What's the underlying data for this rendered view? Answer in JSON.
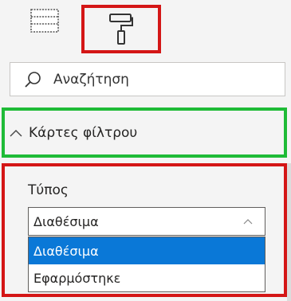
{
  "tabs": {
    "fields_icon": "table-icon",
    "format_icon": "paint-roller-icon"
  },
  "search": {
    "placeholder": "Αναζήτηση",
    "icon": "search-icon"
  },
  "section": {
    "title": "Κάρτες φίλτρου",
    "chevron": "chevron-up-icon"
  },
  "filter_card": {
    "type_label": "Τύπος",
    "selected_value": "Διαθέσιμα",
    "options": [
      {
        "label": "Διαθέσιμα",
        "selected": true
      },
      {
        "label": "Εφαρμόστηκε",
        "selected": false
      }
    ]
  },
  "colors": {
    "highlight_red": "#d41616",
    "highlight_green": "#1fbb37",
    "selection_blue": "#0a78d7"
  }
}
